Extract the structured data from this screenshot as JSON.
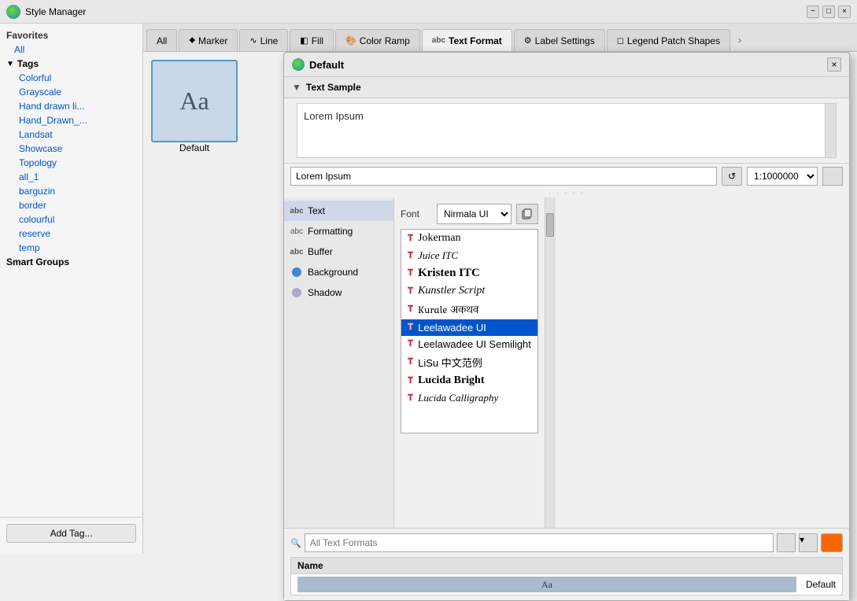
{
  "titlebar": {
    "title": "Style Manager",
    "close": "×",
    "minimize": "−",
    "maximize": "□"
  },
  "tabs": [
    {
      "id": "all",
      "label": "All",
      "icon": ""
    },
    {
      "id": "marker",
      "label": "Marker",
      "icon": "⬥"
    },
    {
      "id": "line",
      "label": "Line",
      "icon": "∿"
    },
    {
      "id": "fill",
      "label": "Fill",
      "icon": "◧"
    },
    {
      "id": "colorramp",
      "label": "Color Ramp",
      "icon": "🎨"
    },
    {
      "id": "textformat",
      "label": "Text Format",
      "icon": "abc"
    },
    {
      "id": "labelsettings",
      "label": "Label Settings",
      "icon": "⚙"
    },
    {
      "id": "legendpatch",
      "label": "Legend Patch Shapes",
      "icon": "◻"
    }
  ],
  "sidebar": {
    "favorites_label": "Favorites",
    "all_label": "All",
    "tags_label": "Tags",
    "tags": [
      "Colorful",
      "Grayscale",
      "Hand drawn li...",
      "Hand_Drawn_...",
      "Landsat",
      "Showcase",
      "Topology",
      "all_1",
      "barguzin",
      "border",
      "colourful",
      "reserve",
      "temp"
    ],
    "smart_groups_label": "Smart Groups",
    "add_tag_btn": "Add Tag..."
  },
  "thumbnail": {
    "text": "Aa",
    "label": "Default"
  },
  "dialog": {
    "title": "Default",
    "close": "×",
    "text_sample_label": "Text Sample",
    "sample_text": "Lorem Ipsum",
    "sample_input_value": "Lorem Ipsum",
    "scale_value": "1:1000000",
    "props": {
      "text_label": "Text",
      "formatting_label": "Formatting",
      "buffer_label": "Buffer",
      "background_label": "Background",
      "shadow_label": "Shadow"
    },
    "font_section": {
      "font_label": "Font",
      "font_value": "Nirmala UI"
    },
    "font_list": [
      {
        "name": "Jokerman",
        "style": "decorative",
        "display": "Jokerman"
      },
      {
        "name": "Juice ITC",
        "style": "italic",
        "display": "Juice ITC"
      },
      {
        "name": "Kristen ITC",
        "style": "bold",
        "display": "Kristen ITC"
      },
      {
        "name": "Kunstler Script",
        "style": "italic",
        "display": "Kunstler Script"
      },
      {
        "name": "Kurale",
        "style": "normal",
        "display": "Kurale  अकथव"
      },
      {
        "name": "Leelawadee UI",
        "style": "selected",
        "display": "Leelawadee UI"
      },
      {
        "name": "Leelawadee UI Semilight",
        "style": "normal",
        "display": "Leelawadee UI Semilight"
      },
      {
        "name": "LiSu",
        "style": "normal",
        "display": "LiSu  中文范例"
      },
      {
        "name": "Lucida Bright",
        "style": "bold",
        "display": "Lucida Bright"
      },
      {
        "name": "Lucida Calligraphy",
        "style": "italic",
        "display": "Lucida Calligraphy"
      }
    ],
    "bottom": {
      "search_placeholder": "All Text Formats",
      "table_header": "Name",
      "table_row_thumb": "Aa",
      "table_row_name": "Default"
    }
  }
}
